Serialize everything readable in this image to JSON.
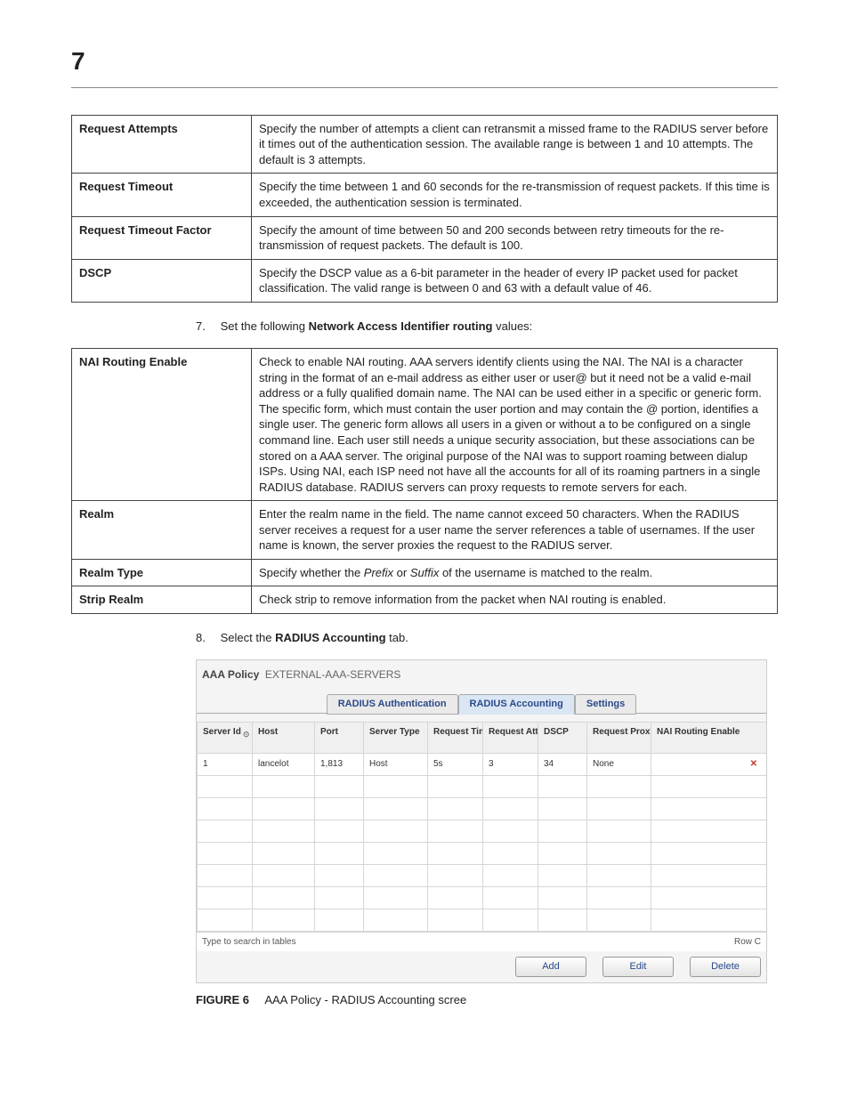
{
  "page_number": "7",
  "table1": {
    "rows": [
      {
        "label": "Request Attempts",
        "desc": "Specify the number of attempts a client can retransmit a missed frame to the RADIUS server before it times out of the authentication session. The available range is between 1 and 10 attempts. The default is 3 attempts."
      },
      {
        "label": "Request Timeout",
        "desc": "Specify the time between 1 and 60 seconds for the re-transmission of request packets. If this time is exceeded, the authentication session is terminated."
      },
      {
        "label": "Request Timeout Factor",
        "desc": "Specify the amount of time between 50 and 200 seconds between retry timeouts for the re-transmission of request packets. The default is 100."
      },
      {
        "label": "DSCP",
        "desc": "Specify the DSCP value as a 6-bit parameter in the header of every IP packet used for packet classification. The valid range is between 0 and 63 with a default value of 46."
      }
    ]
  },
  "step7": {
    "num": "7.",
    "pre": "Set the following ",
    "bold": "Network Access Identifier routing",
    "post": " values:"
  },
  "table2": {
    "rows": [
      {
        "label": "NAI Routing Enable",
        "desc": "Check to enable NAI routing. AAA servers identify clients using the NAI. The NAI is a character string in the format of an e-mail address as either user or user@ but it need not be a valid e-mail address or a fully qualified domain name. The NAI can be used either in a specific or generic form. The specific form, which must contain the user portion and may contain the @ portion, identifies a single user. The generic form allows all users in a given or without a to be configured on a single command line. Each user still needs a unique security association, but these associations can be stored on a AAA server. The original purpose of the NAI was to support roaming between dialup ISPs. Using NAI, each ISP need not have all the accounts for all of its roaming partners in a single RADIUS database. RADIUS servers can proxy requests to remote servers for each."
      },
      {
        "label": "Realm",
        "desc": "Enter the realm name in the field. The name cannot exceed 50 characters. When the RADIUS server receives a request for a user name the server references a table of usernames. If the user name is known, the server proxies the request to the RADIUS server."
      },
      {
        "label": "Realm Type",
        "desc_pre": "Specify whether the ",
        "italic1": "Prefix",
        "mid": " or ",
        "italic2": "Suffix",
        "desc_post": " of the username is matched to the realm."
      },
      {
        "label": "Strip Realm",
        "desc": "Check strip to remove information from the packet when NAI routing is enabled."
      }
    ]
  },
  "step8": {
    "num": "8.",
    "pre": "Select the ",
    "bold": "RADIUS Accounting",
    "post": " tab."
  },
  "screenshot": {
    "title_label": "AAA Policy",
    "title_value": "EXTERNAL-AAA-SERVERS",
    "tabs": [
      {
        "label": "RADIUS Authentication",
        "active": false
      },
      {
        "label": "RADIUS Accounting",
        "active": true
      },
      {
        "label": "Settings",
        "active": false
      }
    ],
    "columns": [
      "Server Id",
      "Host",
      "Port",
      "Server Type",
      "Request Timeout",
      "Request Attempts",
      "DSCP",
      "Request Proxy Mode",
      "NAI Routing Enable"
    ],
    "row": {
      "server_id": "1",
      "host": "lancelot",
      "port": "1,813",
      "server_type": "Host",
      "request_timeout": "5s",
      "request_attempts": "3",
      "dscp": "34",
      "proxy_mode": "None",
      "nai_icon": "✕"
    },
    "search_placeholder": "Type to search in tables",
    "row_count_label": "Row C",
    "buttons": {
      "add": "Add",
      "edit": "Edit",
      "delete": "Delete"
    }
  },
  "figure": {
    "label": "FIGURE 6",
    "caption": "AAA Policy - RADIUS Accounting scree"
  }
}
